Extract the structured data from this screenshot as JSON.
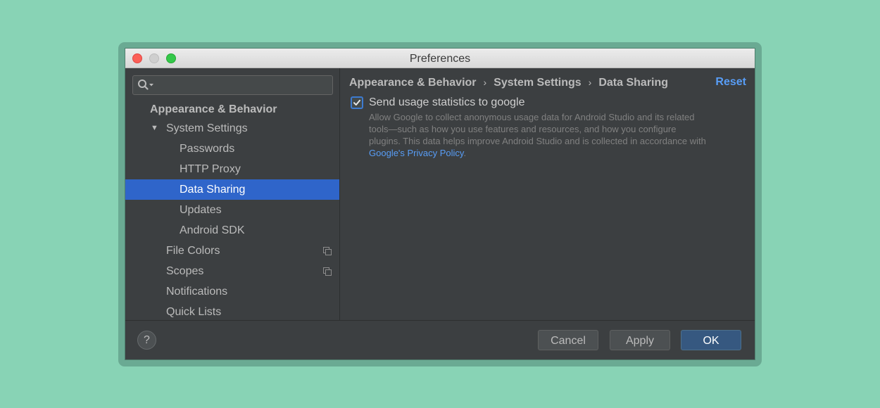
{
  "window": {
    "title": "Preferences"
  },
  "sidebar": {
    "search": {
      "value": "",
      "placeholder": ""
    },
    "items": [
      {
        "label": "Appearance & Behavior",
        "bold": true,
        "selected": false
      },
      {
        "label": "System Settings",
        "expanded": true,
        "selected": false
      },
      {
        "label": "Passwords",
        "selected": false
      },
      {
        "label": "HTTP Proxy",
        "selected": false
      },
      {
        "label": "Data Sharing",
        "selected": true
      },
      {
        "label": "Updates",
        "selected": false
      },
      {
        "label": "Android SDK",
        "selected": false
      },
      {
        "label": "File Colors",
        "icon": "copy-icon",
        "selected": false
      },
      {
        "label": "Scopes",
        "icon": "copy-icon",
        "selected": false
      },
      {
        "label": "Notifications",
        "selected": false
      },
      {
        "label": "Quick Lists",
        "selected": false
      }
    ]
  },
  "content": {
    "breadcrumb": [
      "Appearance & Behavior",
      "System Settings",
      "Data Sharing"
    ],
    "breadcrumb_separator": "›",
    "reset_label": "Reset",
    "checkbox": {
      "label": "Send usage statistics to google",
      "checked": true
    },
    "description": {
      "text": "Allow Google to collect anonymous usage data for Android Studio and its related tools—such as how you use features and resources, and how you configure plugins. This data helps improve Android Studio and is collected in accordance with ",
      "link": "Google's Privacy Policy",
      "suffix": "."
    }
  },
  "footer": {
    "help_label": "?",
    "cancel_label": "Cancel",
    "apply_label": "Apply",
    "ok_label": "OK"
  },
  "colors": {
    "background": "#88d3b5",
    "selection": "#2f65ca",
    "link": "#589df6",
    "ok_button": "#365880"
  }
}
